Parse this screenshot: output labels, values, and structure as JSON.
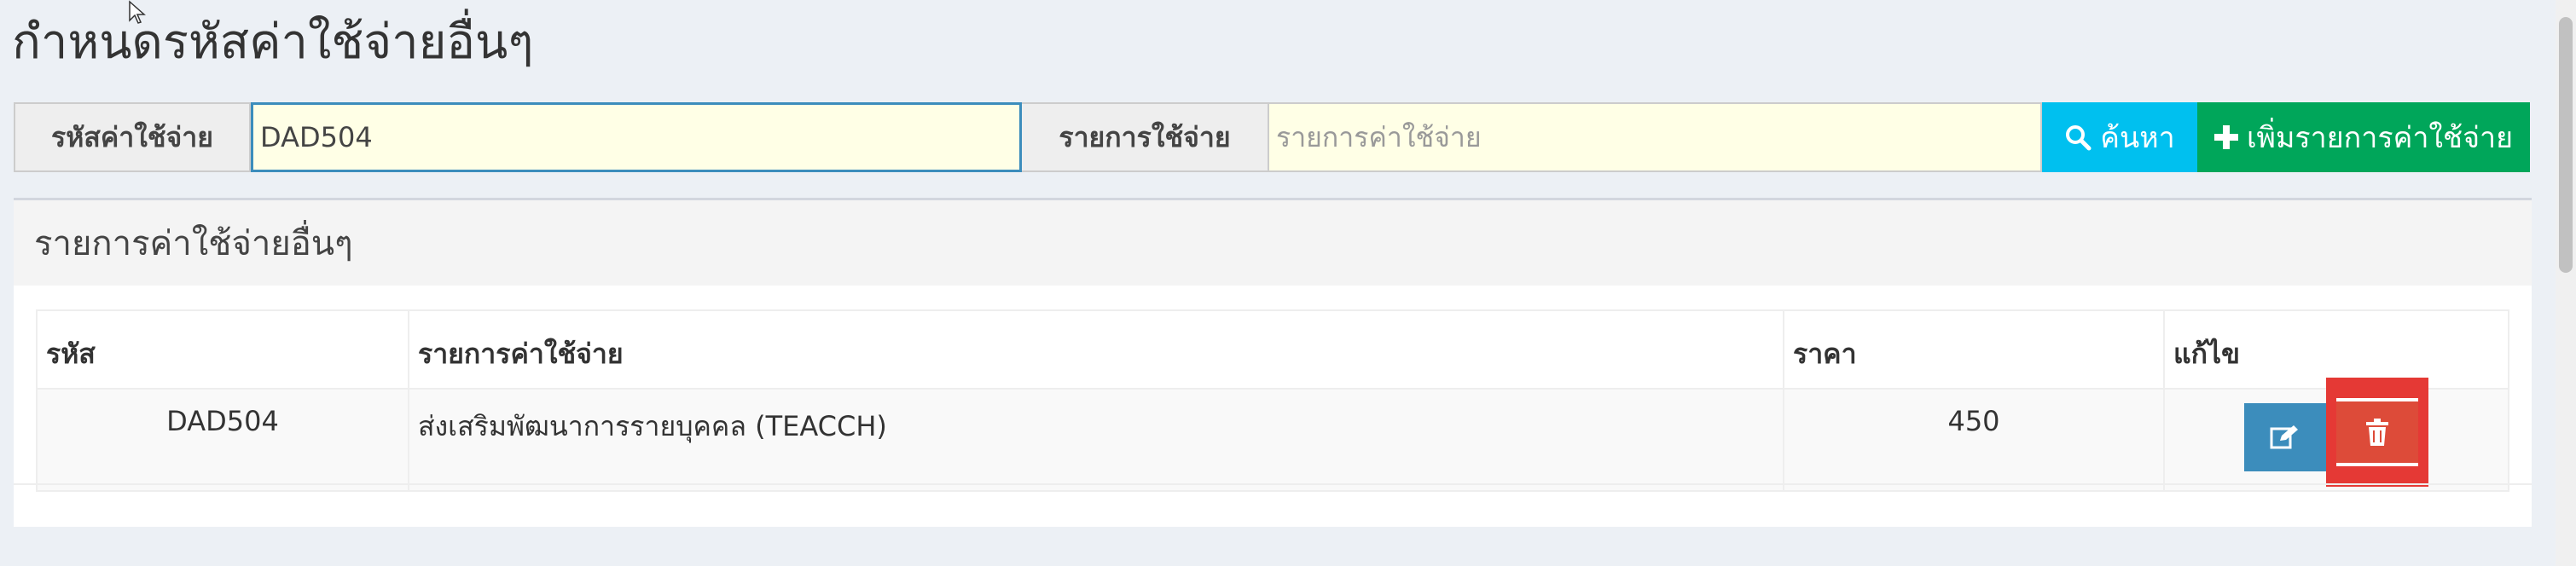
{
  "page": {
    "title": "กำหนดรหัสค่าใช้จ่ายอื่นๆ"
  },
  "search": {
    "code_label": "รหัสค่าใช้จ่าย",
    "code_value": "DAD504",
    "item_label": "รายการใช้จ่าย",
    "item_placeholder": "รายการค่าใช้จ่าย",
    "search_button": "ค้นหา",
    "add_button": "เพิ่มรายการค่าใช้จ่าย"
  },
  "list": {
    "title": "รายการค่าใช้จ่ายอื่นๆ",
    "columns": [
      "รหัส",
      "รายการค่าใช้จ่าย",
      "ราคา",
      "แก้ไข"
    ],
    "rows": [
      {
        "code": "DAD504",
        "name": "ส่งเสริมพัฒนาการรายบุคคล (TEACCH)",
        "price": "450"
      }
    ]
  },
  "colors": {
    "accent": "#3c8dbc",
    "search_button": "#00c0ef",
    "add_button": "#00a65a",
    "delete_button": "#dd4b39",
    "input_bg": "#ffffe6"
  },
  "icons": {
    "search": "search-icon",
    "add": "plus-icon",
    "edit": "edit-icon",
    "delete": "trash-icon"
  }
}
